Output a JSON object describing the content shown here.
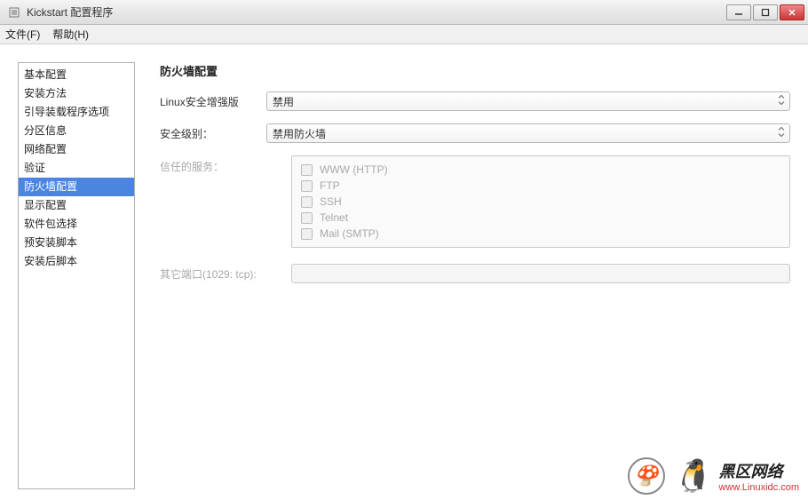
{
  "window": {
    "title": "Kickstart 配置程序"
  },
  "menubar": {
    "file": "文件(F)",
    "help": "帮助(H)"
  },
  "sidebar": {
    "items": [
      {
        "label": "基本配置",
        "selected": false
      },
      {
        "label": "安装方法",
        "selected": false
      },
      {
        "label": "引导装载程序选项",
        "selected": false
      },
      {
        "label": "分区信息",
        "selected": false
      },
      {
        "label": "网络配置",
        "selected": false
      },
      {
        "label": "验证",
        "selected": false
      },
      {
        "label": "防火墙配置",
        "selected": true
      },
      {
        "label": "显示配置",
        "selected": false
      },
      {
        "label": "软件包选择",
        "selected": false
      },
      {
        "label": "预安装脚本",
        "selected": false
      },
      {
        "label": "安装后脚本",
        "selected": false
      }
    ]
  },
  "content": {
    "section_title": "防火墙配置",
    "selinux_label": "Linux安全增强版",
    "selinux_value": "禁用",
    "security_level_label": "安全级别：",
    "security_level_value": "禁用防火墙",
    "trusted_services_label": "信任的服务：",
    "services": [
      {
        "label": "WWW (HTTP)"
      },
      {
        "label": "FTP"
      },
      {
        "label": "SSH"
      },
      {
        "label": "Telnet"
      },
      {
        "label": "Mail (SMTP)"
      }
    ],
    "other_ports_label": "其它端口(1029: tcp):"
  },
  "watermark": {
    "brand": "黑区网络",
    "url": "www.Linuxidc.com"
  }
}
